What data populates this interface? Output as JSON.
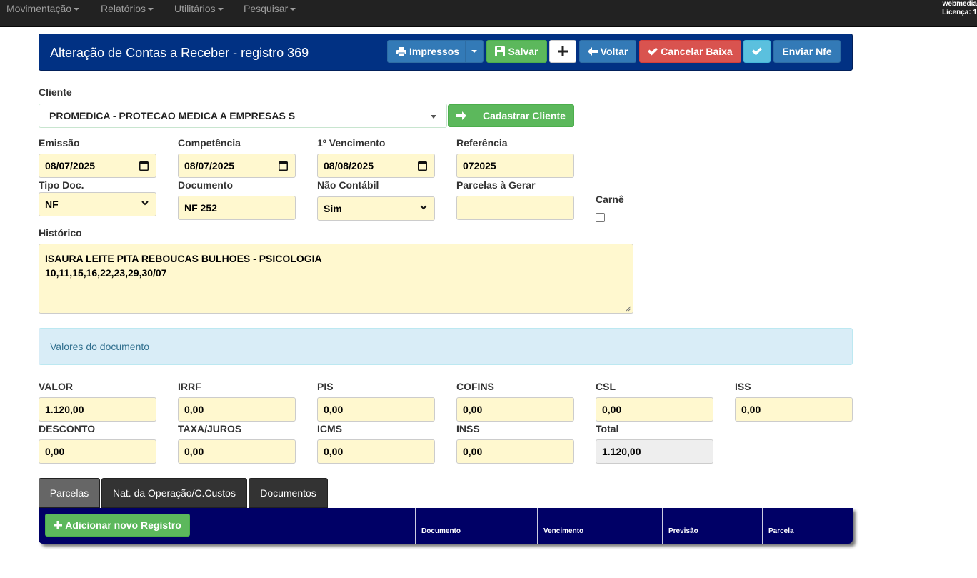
{
  "navbar": {
    "menu": [
      "Movimentação",
      "Relatórios",
      "Utilitários",
      "Pesquisar"
    ],
    "user_line1": "webmedia",
    "user_line2": "Licença: 1"
  },
  "header": {
    "title": "Alteração de Contas a Receber - registro 369",
    "buttons": {
      "impressos": "Impressos",
      "salvar": "Salvar",
      "voltar": "Voltar",
      "cancelar_baixa": "Cancelar Baixa",
      "enviar_nfe": "Enviar Nfe"
    }
  },
  "cliente": {
    "label": "Cliente",
    "value": "PROMEDICA - PROTECAO MEDICA A EMPRESAS S",
    "cadastrar_label": "Cadastrar Cliente"
  },
  "fields": {
    "emissao": {
      "label": "Emissão",
      "value": "08/07/2025"
    },
    "competencia": {
      "label": "Competência",
      "value": "08/07/2025"
    },
    "vencimento": {
      "label": "1º Vencimento",
      "value": "08/08/2025"
    },
    "referencia": {
      "label": "Referência",
      "value": "072025"
    },
    "tipo_doc": {
      "label": "Tipo Doc.",
      "value": "NF"
    },
    "documento": {
      "label": "Documento",
      "value": "NF 252"
    },
    "nao_contabil": {
      "label": "Não Contábil",
      "value": "Sim"
    },
    "parcelas_gerar": {
      "label": "Parcelas à Gerar",
      "value": ""
    },
    "carne": {
      "label": "Carnê",
      "checked": false
    }
  },
  "historico": {
    "label": "Histórico",
    "line1": "ISAURA LEITE PITA REBOUCAS BULHOES - PSICOLOGIA",
    "line2": "10,11,15,16,22,23,29,30/07"
  },
  "valores": {
    "title": "Valores do documento",
    "valor": {
      "label": "VALOR",
      "value": "1.120,00"
    },
    "irrf": {
      "label": "IRRF",
      "value": "0,00"
    },
    "pis": {
      "label": "PIS",
      "value": "0,00"
    },
    "cofins": {
      "label": "COFINS",
      "value": "0,00"
    },
    "csl": {
      "label": "CSL",
      "value": "0,00"
    },
    "iss": {
      "label": "ISS",
      "value": "0,00"
    },
    "desconto": {
      "label": "DESCONTO",
      "value": "0,00"
    },
    "taxa_juros": {
      "label": "TAXA/JUROS",
      "value": "0,00"
    },
    "icms": {
      "label": "ICMS",
      "value": "0,00"
    },
    "inss": {
      "label": "INSS",
      "value": "0,00"
    },
    "total": {
      "label": "Total",
      "value": "1.120,00"
    }
  },
  "tabs": [
    "Parcelas",
    "Nat. da Operação/C.Custos",
    "Documentos"
  ],
  "grid": {
    "add_label": "Adicionar novo Registro",
    "columns": [
      "Documento",
      "Vencimento",
      "Previsão",
      "Parcela"
    ]
  },
  "colors": {
    "header_bg": "#013183",
    "input_bg": "#fff8cf",
    "grid_bg": "#000066",
    "success": "#5cb85c",
    "danger": "#d9534f",
    "primary": "#337ab7",
    "info": "#5bc0de"
  }
}
